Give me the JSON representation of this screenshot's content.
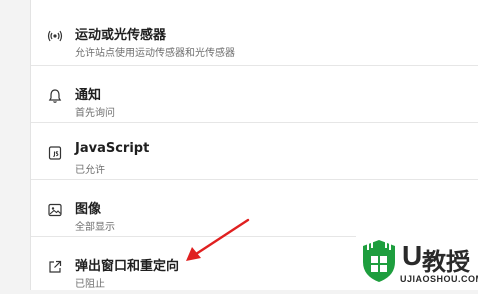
{
  "settings": [
    {
      "title": "运动或光传感器",
      "subtitle": "允许站点使用运动传感器和光传感器",
      "icon": "sensors-icon"
    },
    {
      "title": "通知",
      "subtitle": "首先询问",
      "icon": "bell-icon"
    },
    {
      "title": "JavaScript",
      "subtitle": "已允许",
      "icon": "javascript-icon"
    },
    {
      "title": "图像",
      "subtitle": "全部显示",
      "icon": "image-icon"
    },
    {
      "title": "弹出窗口和重定向",
      "subtitle": "已阻止",
      "icon": "popup-redirect-icon"
    }
  ],
  "watermark": {
    "brand_u": "U",
    "brand_cn": "教授",
    "url": "UJIAOSHOU.COM"
  },
  "colors": {
    "arrow": "#e02020",
    "watermark_green": "#1e9e3e"
  }
}
